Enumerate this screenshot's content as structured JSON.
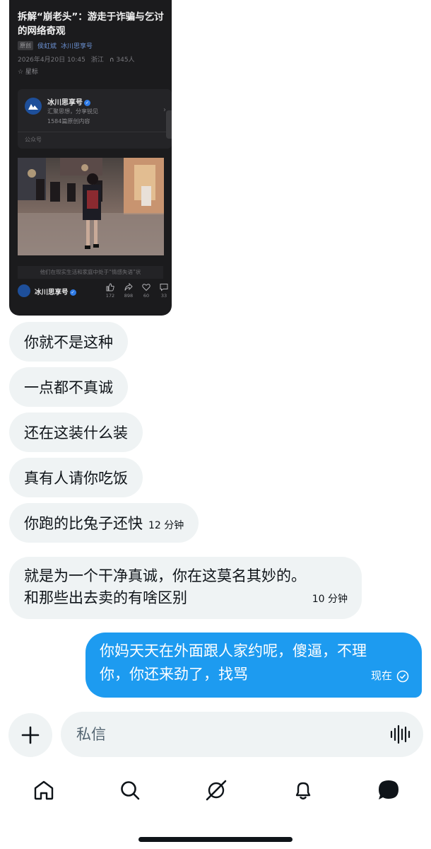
{
  "shared_card": {
    "title": "拆解“崩老头”：游走于诈骗与乞讨的网络奇观",
    "tag": "原创",
    "author": "侯虹斌",
    "account_link": "冰川思享号",
    "date": "2026年4月20日 10:45",
    "location": "浙江",
    "listeners": "345人",
    "star_label": "☆ 星标",
    "account": {
      "name": "冰川思享号",
      "description": "汇聚思想，分享锐见",
      "count": "1584篇原创内容",
      "type": "公众号"
    },
    "caption": "他们在现实生活和家庭中处于“情感失语”状",
    "footer_name": "冰川思享号",
    "stats": {
      "likes": "172",
      "shares": "898",
      "favorites": "60",
      "comments": "33"
    }
  },
  "messages": {
    "incoming": [
      {
        "text": "你就不是这种"
      },
      {
        "text": "一点都不真诚"
      },
      {
        "text": "还在这装什么装"
      },
      {
        "text": "真有人请你吃饭"
      },
      {
        "text": "你跑的比兔子还快",
        "time": "12 分钟"
      },
      {
        "line1": "就是为一个干净真诚，你在这莫名其妙的。",
        "line2": "和那些出去卖的有啥区别",
        "time": "10 分钟"
      }
    ],
    "outgoing": {
      "line1": "你妈天天在外面跟人家约呢，傻逼，不理",
      "line2": "你，你还来劲了，找骂",
      "status": "现在"
    }
  },
  "compose": {
    "placeholder": "私信"
  },
  "colors": {
    "accent": "#1d9bf0",
    "bubble_in": "#eff3f4",
    "card_bg": "#1b1b1d"
  },
  "icons": {
    "nav": [
      "home-icon",
      "search-icon",
      "grok-icon",
      "notifications-icon",
      "messages-icon"
    ],
    "compose": [
      "plus-icon",
      "voice-icon"
    ]
  }
}
